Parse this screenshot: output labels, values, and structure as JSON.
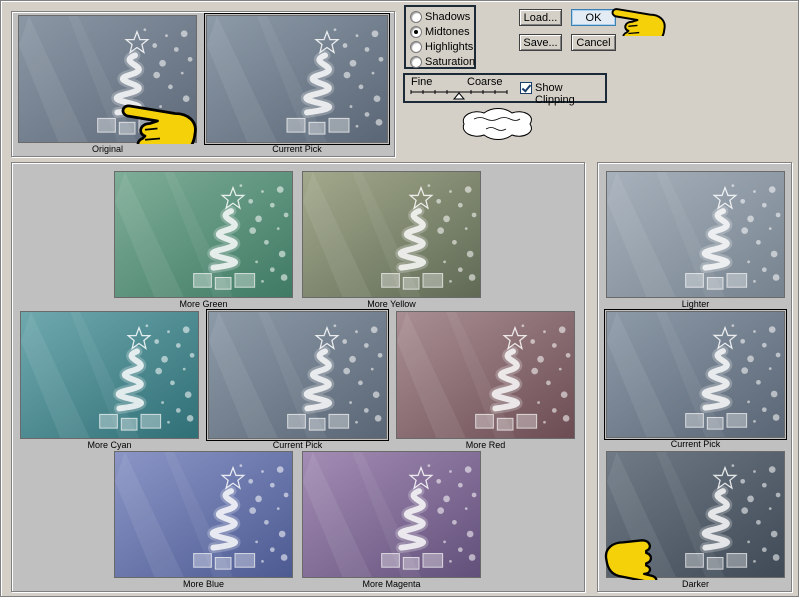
{
  "top": {
    "original_label": "Original",
    "current_pick_label": "Current Pick"
  },
  "tonal": {
    "options": [
      {
        "label": "Shadows",
        "checked": false
      },
      {
        "label": "Midtones",
        "checked": true
      },
      {
        "label": "Highlights",
        "checked": false
      },
      {
        "label": "Saturation",
        "checked": false
      }
    ]
  },
  "slider": {
    "fine_label": "Fine",
    "coarse_label": "Coarse",
    "position_fraction": 0.5
  },
  "show_clipping": {
    "label": "Show Clipping",
    "checked": true
  },
  "buttons": {
    "load": "Load...",
    "ok": "OK",
    "save": "Save...",
    "cancel": "Cancel"
  },
  "variations": {
    "more_green": "More Green",
    "more_yellow": "More Yellow",
    "more_cyan": "More Cyan",
    "current_pick": "Current Pick",
    "more_red": "More Red",
    "more_blue": "More Blue",
    "more_magenta": "More Magenta"
  },
  "brightness": {
    "lighter": "Lighter",
    "current_pick": "Current Pick",
    "darker": "Darker"
  },
  "colors": {
    "original": [
      "#8b97a5",
      "#5e6a79"
    ],
    "current": [
      "#8d9aa8",
      "#5a6675"
    ],
    "green": [
      "#7fae98",
      "#3f7a64"
    ],
    "yellow": [
      "#a3a98c",
      "#5f6a55"
    ],
    "cyan": [
      "#6fa9ae",
      "#2f6f76"
    ],
    "red": [
      "#a98f93",
      "#6b4c52"
    ],
    "blue": [
      "#8b96c6",
      "#4c5a92"
    ],
    "magenta": [
      "#a48db5",
      "#62507a"
    ],
    "lighter": [
      "#a7b1bc",
      "#76838f"
    ],
    "darker": [
      "#6f7a86",
      "#3f4a56"
    ],
    "hand_yellow": "#f5d10a"
  }
}
